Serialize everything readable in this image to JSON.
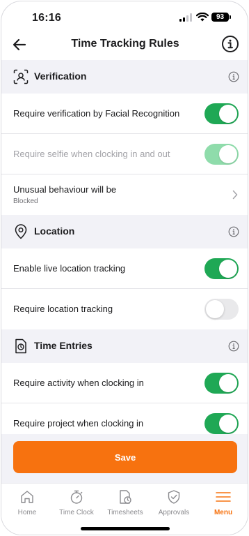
{
  "status_bar": {
    "time": "16:16",
    "battery": "93"
  },
  "header": {
    "title": "Time Tracking Rules"
  },
  "sections": {
    "verification": {
      "title": "Verification",
      "rows": {
        "facial": {
          "label": "Require verification by Facial Recognition",
          "on": true
        },
        "selfie": {
          "label": "Require selfie when clocking in and out",
          "on": true,
          "disabled": true
        },
        "unusual": {
          "label": "Unusual behaviour will be",
          "value": "Blocked"
        }
      }
    },
    "location": {
      "title": "Location",
      "rows": {
        "live": {
          "label": "Enable live location tracking",
          "on": true
        },
        "require": {
          "label": "Require location tracking",
          "on": false
        }
      }
    },
    "time_entries": {
      "title": "Time Entries",
      "rows": {
        "activity": {
          "label": "Require activity when clocking in",
          "on": true
        },
        "project": {
          "label": "Require project when clocking in",
          "on": true
        }
      }
    }
  },
  "save_label": "Save",
  "tabs": [
    {
      "label": "Home",
      "icon": "home-icon"
    },
    {
      "label": "Time Clock",
      "icon": "stopwatch-icon"
    },
    {
      "label": "Timesheets",
      "icon": "timesheet-icon"
    },
    {
      "label": "Approvals",
      "icon": "shield-check-icon"
    },
    {
      "label": "Menu",
      "icon": "menu-icon",
      "active": true
    }
  ],
  "colors": {
    "accent": "#f7720f",
    "toggle_on": "#1fa855",
    "toggle_disabled": "#8fdcab",
    "toggle_off": "#e9e9eb",
    "section_bg": "#f2f2f7"
  }
}
